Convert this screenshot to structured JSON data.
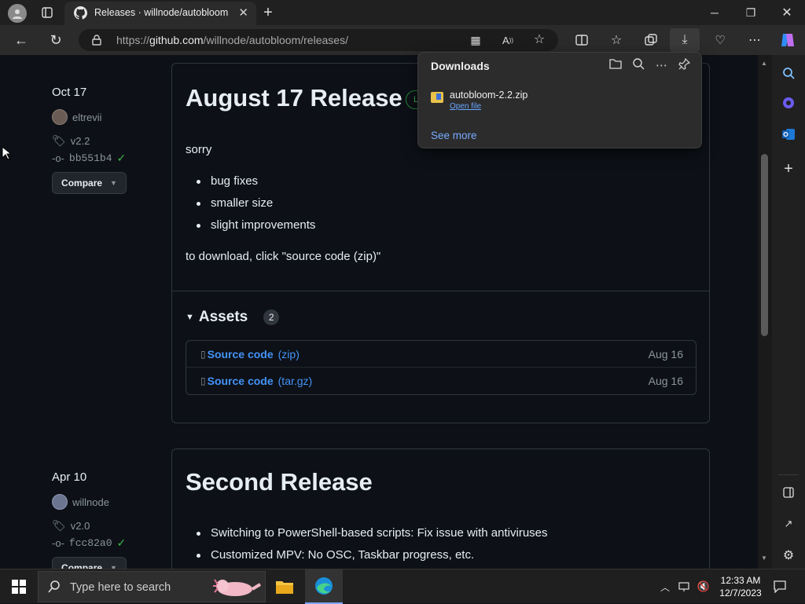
{
  "browser": {
    "tab_title": "Releases · willnode/autobloom",
    "url_prefix": "https://",
    "url_domain": "github.com",
    "url_path": "/willnode/autobloom/releases/"
  },
  "downloads": {
    "title": "Downloads",
    "file_name": "autobloom-2.2.zip",
    "open_label": "Open file",
    "see_more": "See more"
  },
  "release1": {
    "date": "Oct 17",
    "author": "eltrevii",
    "tag": "v2.2",
    "commit": "bb551b4",
    "compare_label": "Compare",
    "title": "August 17 Release",
    "badge_initial": "L",
    "intro": "sorry",
    "bullets": [
      "bug fixes",
      "smaller size",
      "slight improvements"
    ],
    "outro": "to download, click \"source code (zip)\"",
    "assets_label": "Assets",
    "assets_count": "2",
    "assets": [
      {
        "name": "Source code",
        "ext": "(zip)",
        "date": "Aug 16"
      },
      {
        "name": "Source code",
        "ext": "(tar.gz)",
        "date": "Aug 16"
      }
    ]
  },
  "release2": {
    "date": "Apr 10",
    "author": "willnode",
    "tag": "v2.0",
    "commit": "fcc82a0",
    "compare_label": "Compare",
    "title": "Second Release",
    "bullets": [
      "Switching to PowerShell-based scripts: Fix issue with antiviruses",
      "Customized MPV: No OSC, Taskbar progress, etc."
    ]
  },
  "taskbar": {
    "search_placeholder": "Type here to search",
    "time": "12:33 AM",
    "date": "12/7/2023"
  },
  "colors": {
    "link": "#4493f8",
    "verified": "#3fb950",
    "page_bg": "#0d1117"
  }
}
